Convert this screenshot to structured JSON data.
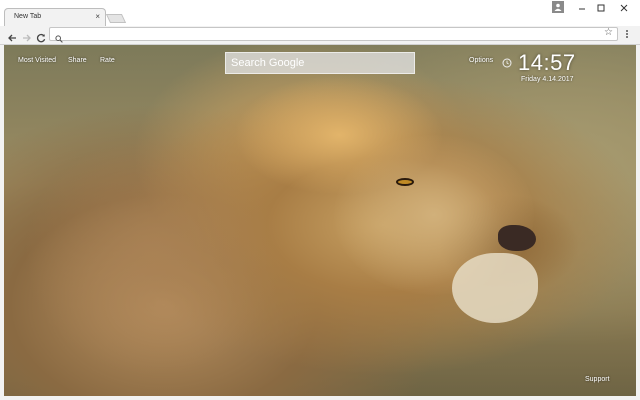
{
  "browser": {
    "tab": {
      "title": "New Tab",
      "close_symbol": "×"
    },
    "toolbar": {
      "bookmark_symbol": "☆"
    },
    "icons": [
      "user-icon",
      "minimize-icon",
      "maximize-icon",
      "close-icon",
      "back-arrow-icon",
      "forward-arrow-icon",
      "reload-icon",
      "search-icon",
      "star-icon",
      "menu-icon"
    ]
  },
  "newtab": {
    "links": {
      "most_visited": "Most Visited",
      "share": "Share",
      "rate": "Rate",
      "options": "Options",
      "support": "Support"
    },
    "search": {
      "placeholder": "Search Google"
    },
    "clock": {
      "time": "14:57",
      "date": "Friday  4.14.2017"
    },
    "background": {
      "subject": "lion",
      "colors": [
        "#c7a062",
        "#8a6a42",
        "#9c8c62"
      ]
    }
  }
}
